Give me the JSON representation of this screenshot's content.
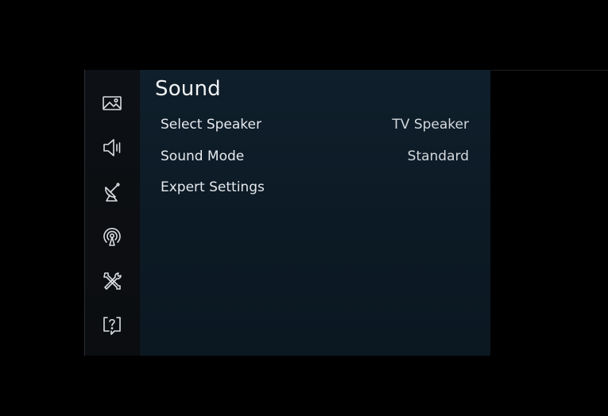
{
  "sidebar": {
    "items": [
      {
        "icon": "picture-icon"
      },
      {
        "icon": "speaker-icon"
      },
      {
        "icon": "broadcasting-icon"
      },
      {
        "icon": "network-icon"
      },
      {
        "icon": "tools-icon"
      },
      {
        "icon": "support-icon"
      }
    ]
  },
  "panel": {
    "title": "Sound",
    "items": [
      {
        "label": "Select Speaker",
        "value": "TV Speaker"
      },
      {
        "label": "Sound Mode",
        "value": "Standard"
      },
      {
        "label": "Expert Settings",
        "value": ""
      }
    ]
  },
  "colors": {
    "background": "#000000",
    "panel": "#0f1f2b",
    "sidebar": "#0d1014",
    "text": "#e6eaee"
  }
}
